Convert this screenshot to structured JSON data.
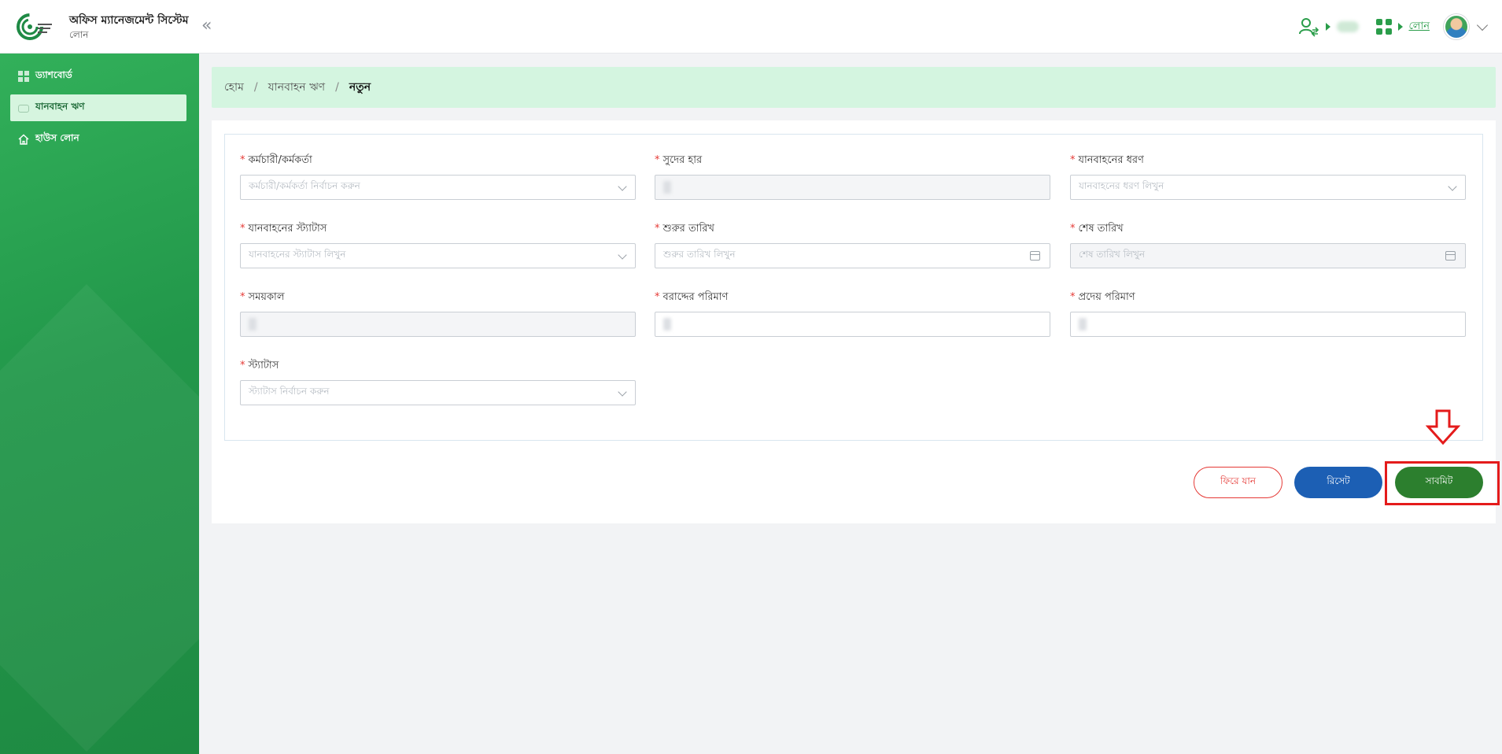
{
  "header": {
    "app_title": "অফিস ম্যানেজমেন্ট সিস্টেম",
    "app_subtitle": "লোন",
    "collapse_glyph": "«",
    "module_link": "লোন",
    "icons": [
      "user-switch-icon",
      "apps-grid-icon",
      "user-avatar",
      "chevron-down-icon"
    ]
  },
  "sidebar": {
    "items": [
      {
        "label": "ড্যাশবোর্ড",
        "icon": "dashboard-icon",
        "active": false
      },
      {
        "label": "যানবাহন ঋণ",
        "icon": "car-icon",
        "active": true
      },
      {
        "label": "হাউস লোন",
        "icon": "house-icon",
        "active": false
      }
    ]
  },
  "breadcrumb": {
    "items": [
      "হোম",
      "যানবাহন ঋণ"
    ],
    "separator": "/",
    "current": "নতুন"
  },
  "form": {
    "required_mark": "*",
    "employee": {
      "label": "কর্মচারী/কর্মকর্তা",
      "placeholder": "কর্মচারী/কর্মকর্তা নির্বাচন করুন"
    },
    "interest_rate": {
      "label": "সুদের হার"
    },
    "vehicle_type": {
      "label": "যানবাহনের ধরণ",
      "placeholder": "যানবাহনের ধরণ লিখুন"
    },
    "vehicle_status": {
      "label": "যানবাহনের স্ট্যাটাস",
      "placeholder": "যানবাহনের স্ট্যাটাস লিখুন"
    },
    "start_date": {
      "label": "শুরুর তারিখ",
      "placeholder": "শুরুর তারিখ লিখুন"
    },
    "end_date": {
      "label": "শেষ তারিখ",
      "placeholder": "শেষ তারিখ লিখুন"
    },
    "duration": {
      "label": "সময়কাল"
    },
    "allocated_amount": {
      "label": "বরাদ্দের পরিমাণ"
    },
    "payable_amount": {
      "label": "প্রদেয় পরিমাণ"
    },
    "status": {
      "label": "স্ট্যাটাস",
      "placeholder": "স্ট্যাটাস নির্বাচন করুন"
    }
  },
  "actions": {
    "back": "ফিরে যান",
    "reset": "রিসেট",
    "submit": "সাবমিট"
  },
  "colors": {
    "sidebar_green": "#22974a",
    "breadcrumb_bg": "#d4f5e0",
    "submit_green": "#2c7f2e",
    "reset_blue": "#1c5fb4",
    "back_red": "#e53935",
    "annotation_red": "#e41b1b"
  }
}
